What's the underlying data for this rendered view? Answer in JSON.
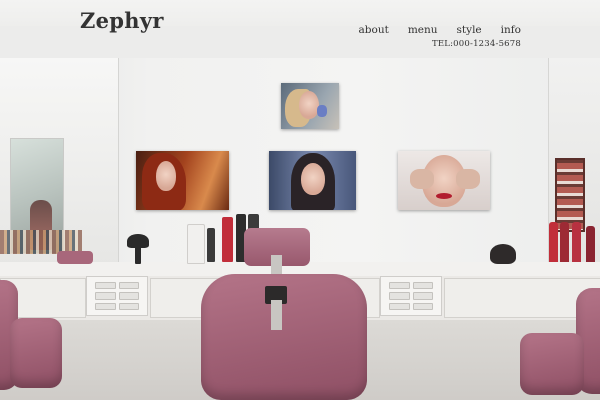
{
  "site": {
    "logo": "Zephyr"
  },
  "nav": {
    "items": [
      {
        "label": "about"
      },
      {
        "label": "menu"
      },
      {
        "label": "style"
      },
      {
        "label": "info"
      }
    ]
  },
  "contact": {
    "tel": "TEL:000-1234-5678"
  },
  "hero": {
    "photo_subject": "hair-salon-interior-with-pink-chairs-and-portrait-posters"
  },
  "colors": {
    "text": "#333333",
    "chair": "#a05f74",
    "wall": "#f2f2f1",
    "accent_red": "#c12e3a"
  }
}
